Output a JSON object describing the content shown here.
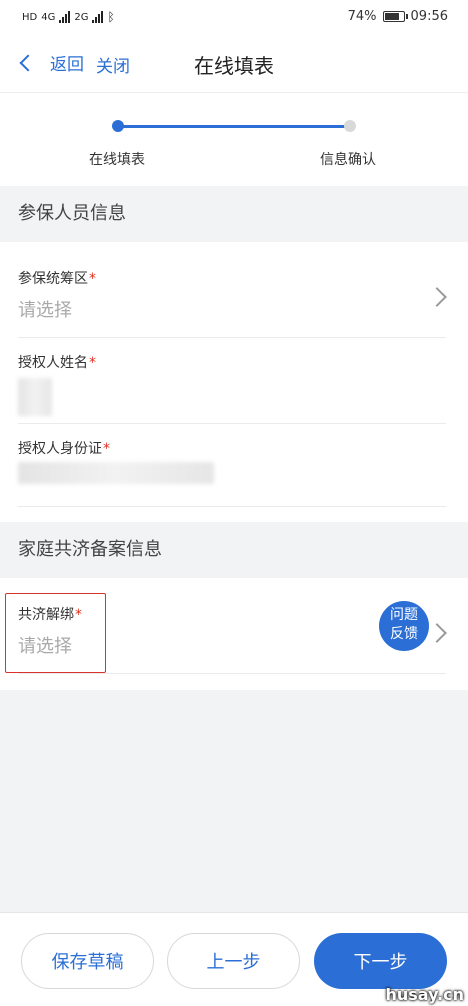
{
  "status_bar": {
    "network_left": "HD",
    "sim1": "4G",
    "sim2": "2G",
    "battery": "74%",
    "battery_level": 0.74,
    "time": "09:56"
  },
  "nav": {
    "back_label": "返回",
    "close_label": "关闭",
    "title": "在线填表"
  },
  "stepper": {
    "steps": [
      {
        "label": "在线填表"
      },
      {
        "label": "信息确认"
      }
    ]
  },
  "sections": {
    "insured": {
      "title": "参保人员信息",
      "fields": [
        {
          "label": "参保统筹区",
          "required": "*",
          "placeholder": "请选择"
        },
        {
          "label": "授权人姓名",
          "required": "*"
        },
        {
          "label": "授权人身份证",
          "required": "*"
        }
      ]
    },
    "family": {
      "title": "家庭共济备案信息",
      "fields": [
        {
          "label": "共济解绑",
          "required": "*",
          "placeholder": "请选择"
        }
      ]
    }
  },
  "feedback": {
    "line1": "问题",
    "line2": "反馈"
  },
  "bottom": {
    "save_draft": "保存草稿",
    "prev": "上一步",
    "next": "下一步"
  },
  "watermark": "husay.cn",
  "colors": {
    "accent": "#2b6fd6",
    "required": "#e0311e",
    "highlight": "#d9342b"
  }
}
